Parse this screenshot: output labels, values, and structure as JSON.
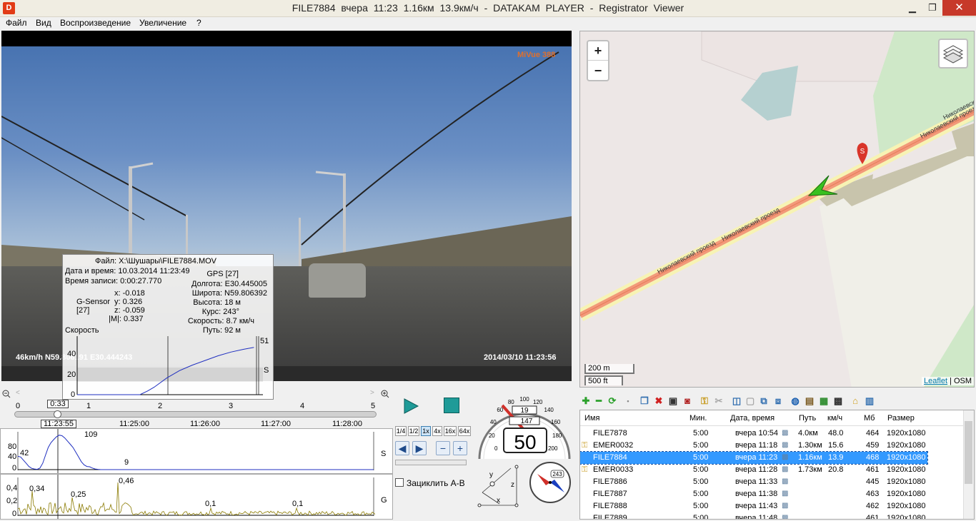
{
  "window": {
    "title": "FILE7884   вчера 11:23   1.16км   13.9км/ч  -  DATAKAM PLAYER - Registrator Viewer",
    "app_icon": "D",
    "minimize": "▁",
    "maximize": "❐",
    "close": "✕"
  },
  "menu": [
    "Файл",
    "Вид",
    "Воспроизведение",
    "Увеличение",
    "?"
  ],
  "video": {
    "brand_osd": "MiVue 388",
    "left_osd": "46km/h N59.806191 E30.444243",
    "right_osd": "2014/03/10 11:23:56"
  },
  "info_overlay": {
    "file": "Файл: X:\\Шушары\\FILE7884.MOV",
    "datetime": "Дата и время: 10.03.2014 11:23:49",
    "record_time": "Время записи: 0:00:27.770",
    "gps_label": "GPS [27]",
    "longitude": "Долгота: E30.445005",
    "latitude": "Широта: N59.806392",
    "altitude": "Высота: 18 м",
    "course": "Курс: 243°",
    "speed": "Скорость: 8.7 км/ч",
    "path": "Путь: 92 м",
    "gsensor_label": "G-Sensor",
    "gsensor_count": "[27]",
    "gx": "x: -0.018",
    "gy": "y:  0.326",
    "gz": "z: -0.059",
    "gm": "|M|:  0.337",
    "graph_label": "Скорость",
    "graph_ticks": [
      "40",
      "20",
      "0"
    ],
    "graph_max": "51",
    "graph_s": "S",
    "speed_curve": [
      [
        0,
        0
      ],
      [
        10,
        0
      ],
      [
        20,
        0
      ],
      [
        30,
        0
      ],
      [
        40,
        0
      ],
      [
        49,
        0
      ],
      [
        55,
        4
      ],
      [
        60,
        8
      ],
      [
        70,
        18
      ],
      [
        80,
        26
      ],
      [
        90,
        32
      ],
      [
        100,
        37
      ],
      [
        110,
        42
      ],
      [
        120,
        46
      ],
      [
        130,
        49
      ],
      [
        138,
        51
      ]
    ]
  },
  "timeline": {
    "position_box": "0:33",
    "minute_ticks": [
      "0",
      "1",
      "2",
      "3",
      "4",
      "5"
    ],
    "current_time": "11:23:55",
    "clock_labels": [
      "11:25:00",
      "11:26:00",
      "11:27:00",
      "11:28:00"
    ],
    "position_fraction": 0.11
  },
  "speed_graph": {
    "label": "S",
    "y_ticks": [
      "80",
      "40",
      "0"
    ],
    "annotations": [
      "42",
      "109",
      "9"
    ],
    "values": [
      42,
      40,
      30,
      20,
      10,
      4,
      2,
      1,
      5,
      20,
      45,
      70,
      85,
      95,
      104,
      109,
      107,
      100,
      90,
      80,
      70,
      55,
      40,
      25,
      15,
      10,
      9,
      5,
      2,
      1,
      0,
      0,
      0,
      0,
      0,
      0,
      0,
      0,
      0,
      0,
      0,
      0,
      0,
      0,
      0,
      0,
      0,
      0,
      0,
      0
    ]
  },
  "g_graph": {
    "label": "G",
    "y_ticks": [
      "0,4",
      "0,2",
      "0"
    ],
    "annotations": [
      "0,34",
      "0,25",
      "0,46",
      "0,1",
      "0,1"
    ]
  },
  "playback": {
    "speeds": [
      "1/4",
      "1/2",
      "1x",
      "4x",
      "16x",
      "64x"
    ],
    "active_speed": "1x",
    "prev": "◀",
    "next": "▶",
    "zoom_out": "−",
    "zoom_in": "+",
    "loop_label": "Зациклить А-В"
  },
  "speedometer": {
    "ticks": [
      "0",
      "20",
      "40",
      "60",
      "80",
      "100",
      "120",
      "140",
      "160",
      "180",
      "200"
    ],
    "trip": "19",
    "odo": "147",
    "speed": "50"
  },
  "sensor": {
    "x": "x",
    "y": "y",
    "z": "z"
  },
  "compass": {
    "heading": "243"
  },
  "map": {
    "zoom_in": "+",
    "zoom_out": "−",
    "scale_metric": "200 m",
    "scale_imperial": "500 ft",
    "attribution_link": "Leaflet",
    "attribution_text": " | OSM",
    "street_labels": [
      "Николаевский проезд",
      "Николаевский проезд",
      "Николаевский проезд",
      "Николаевский проезд"
    ],
    "marker_label": "S"
  },
  "file_list": {
    "headers": [
      "Имя",
      "Мин.",
      "Дата, время",
      "Путь",
      "км/ч",
      "Мб",
      "Размер"
    ],
    "rows": [
      {
        "name": "FILE7878",
        "min": "5:00",
        "date": "вчера 10:54",
        "path": "4.0км",
        "speed": "48.0",
        "mb": "464",
        "size": "1920x1080",
        "locked": false
      },
      {
        "name": "EMER0032",
        "min": "5:00",
        "date": "вчера 11:18",
        "path": "1.30км",
        "speed": "15.6",
        "mb": "459",
        "size": "1920x1080",
        "locked": true
      },
      {
        "name": "FILE7884",
        "min": "5:00",
        "date": "вчера 11:23",
        "path": "1.16км",
        "speed": "13.9",
        "mb": "468",
        "size": "1920x1080",
        "locked": false
      },
      {
        "name": "EMER0033",
        "min": "5:00",
        "date": "вчера 11:28",
        "path": "1.73км",
        "speed": "20.8",
        "mb": "461",
        "size": "1920x1080",
        "locked": true
      },
      {
        "name": "FILE7886",
        "min": "5:00",
        "date": "вчера 11:33",
        "path": "",
        "speed": "",
        "mb": "445",
        "size": "1920x1080",
        "locked": false
      },
      {
        "name": "FILE7887",
        "min": "5:00",
        "date": "вчера 11:38",
        "path": "",
        "speed": "",
        "mb": "463",
        "size": "1920x1080",
        "locked": false
      },
      {
        "name": "FILE7888",
        "min": "5:00",
        "date": "вчера 11:43",
        "path": "",
        "speed": "",
        "mb": "462",
        "size": "1920x1080",
        "locked": false
      },
      {
        "name": "FILE7889",
        "min": "5:00",
        "date": "вчера 11:48",
        "path": "",
        "speed": "",
        "mb": "461",
        "size": "1920x1080",
        "locked": false
      }
    ],
    "selected_index": 2
  },
  "colors": {
    "accent_selection": "#3399ff",
    "speed_line": "#1f2fc0",
    "g_line": "#8a7a00",
    "route": "#f29a7a",
    "marker": "#d9352a",
    "arrow": "#39c020"
  }
}
